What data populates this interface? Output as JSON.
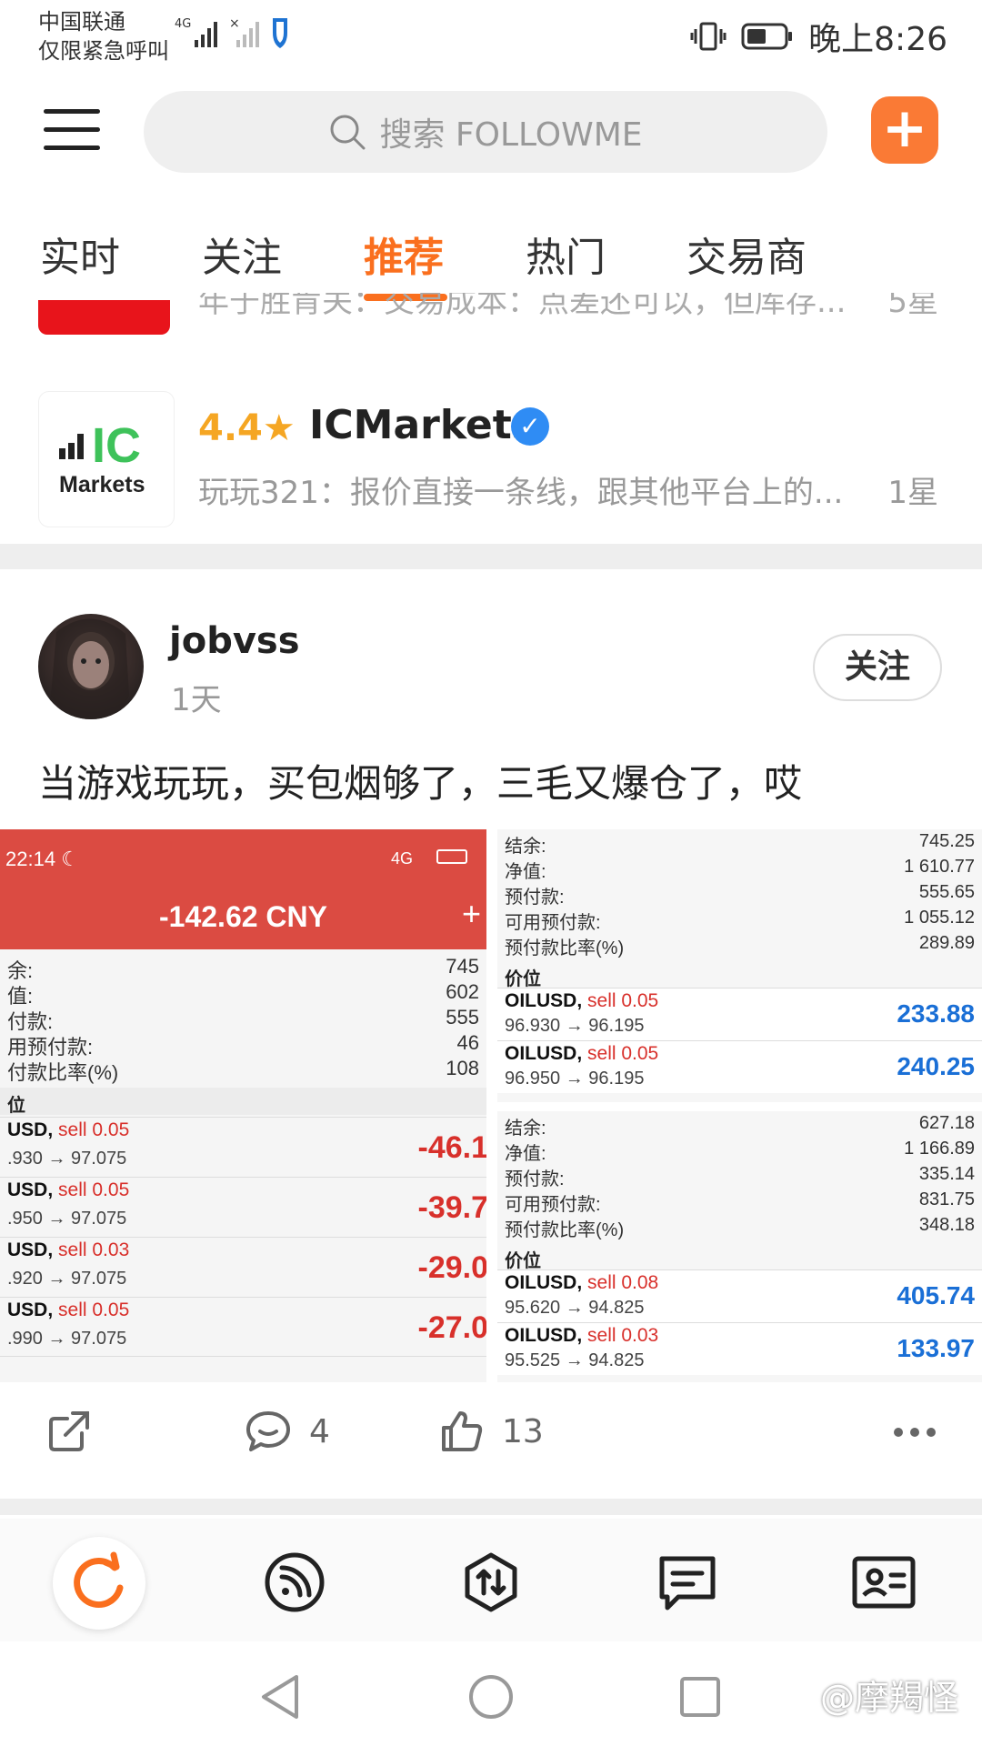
{
  "status_bar": {
    "carrier_line1": "中国联通",
    "carrier_line2": "仅限紧急呼叫",
    "network_label": "4G",
    "time": "晚上8:26"
  },
  "header": {
    "search_placeholder": "搜索 FOLLOWME",
    "plus_label": "+"
  },
  "tabs": [
    {
      "label": "实时"
    },
    {
      "label": "关注"
    },
    {
      "label": "推荐",
      "active": true
    },
    {
      "label": "热门"
    },
    {
      "label": "交易商"
    }
  ],
  "prev_item": {
    "cut_text": "年于胜肯关：交易成本：点差还可以，但库存...",
    "cut_star": "5星"
  },
  "broker": {
    "logo_text_top": "IC",
    "logo_text_bottom": "Markets",
    "rating": "4.4",
    "name": "ICMarkets",
    "comment": "玩玩321：报价直接一条线，跟其他平台上的...",
    "star": "1星"
  },
  "post": {
    "username": "jobvss",
    "time": "1天",
    "follow_label": "关注",
    "text": "当游戏玩玩，买包烟够了，三毛又爆仓了，哎",
    "comments": "4",
    "likes": "13"
  },
  "shot_left": {
    "time": "22:14",
    "net": "4G",
    "amount": "-142.62 CNY",
    "rows": [
      {
        "k": "余:",
        "v": "745"
      },
      {
        "k": "值:",
        "v": "602"
      },
      {
        "k": "付款:",
        "v": "555"
      },
      {
        "k": "用预付款:",
        "v": "46"
      },
      {
        "k": "付款比率(%)",
        "v": "108"
      }
    ],
    "section": "位",
    "trades": [
      {
        "sym": "USD,",
        "side": "sell 0.05",
        "price": ".930 → 97.075",
        "pl": "-46.1"
      },
      {
        "sym": "USD,",
        "side": "sell 0.05",
        "price": ".950 → 97.075",
        "pl": "-39.7"
      },
      {
        "sym": "USD,",
        "side": "sell 0.03",
        "price": ".920 → 97.075",
        "pl": "-29.0"
      },
      {
        "sym": "USD,",
        "side": "sell 0.05",
        "price": ".990 → 97.075",
        "pl": "-27.0"
      }
    ]
  },
  "shot_r1": {
    "rows": [
      {
        "k": "结余:",
        "v": "745.25"
      },
      {
        "k": "净值:",
        "v": "1 610.77"
      },
      {
        "k": "预付款:",
        "v": "555.65"
      },
      {
        "k": "可用预付款:",
        "v": "1 055.12"
      },
      {
        "k": "预付款比率(%)",
        "v": "289.89"
      }
    ],
    "section": "价位",
    "trades": [
      {
        "sym": "OILUSD,",
        "side": "sell 0.05",
        "price": "96.930 → 96.195",
        "pl": "233.88"
      },
      {
        "sym": "OILUSD,",
        "side": "sell 0.05",
        "price": "96.950 → 96.195",
        "pl": "240.25"
      }
    ]
  },
  "shot_r2": {
    "rows": [
      {
        "k": "结余:",
        "v": "627.18"
      },
      {
        "k": "净值:",
        "v": "1 166.89"
      },
      {
        "k": "预付款:",
        "v": "335.14"
      },
      {
        "k": "可用预付款:",
        "v": "831.75"
      },
      {
        "k": "预付款比率(%)",
        "v": "348.18"
      }
    ],
    "section": "价位",
    "trades": [
      {
        "sym": "OILUSD,",
        "side": "sell 0.08",
        "price": "95.620 → 94.825",
        "pl": "405.74"
      },
      {
        "sym": "OILUSD,",
        "side": "sell 0.03",
        "price": "95.525 → 94.825",
        "pl": "133.97"
      }
    ]
  },
  "watermark": "@摩羯怪",
  "colors": {
    "accent": "#fa6f1e",
    "profit_blue": "#1a6fd6",
    "loss_red": "#d8302b",
    "header_red": "#db4b42"
  }
}
